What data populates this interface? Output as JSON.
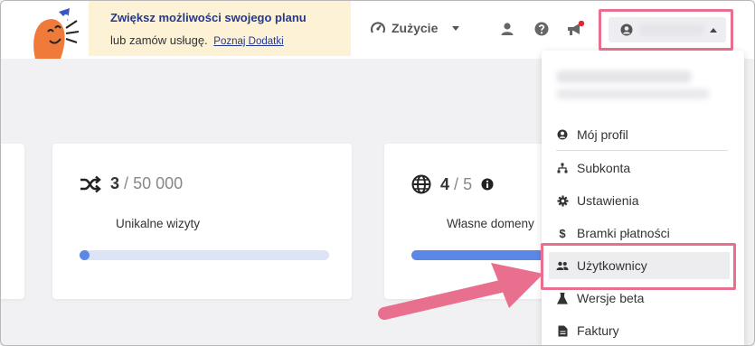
{
  "promo": {
    "title": "Zwiększ możliwości swojego planu",
    "line": "lub zamów usługę.",
    "link": "Poznaj Dodatki"
  },
  "header": {
    "usage_label": "Zużycie",
    "icons": [
      "speedometer-icon",
      "user-icon",
      "help-icon",
      "megaphone-icon",
      "account-icon"
    ]
  },
  "cards": [
    {
      "icon": "shuffle-icon",
      "current": "3",
      "separator": "/",
      "max": "50 000",
      "label": "Unikalne wizyty",
      "progress_fraction": 6e-05
    },
    {
      "icon": "globe-icon",
      "current": "4",
      "separator": "/",
      "max": "5",
      "label": "Własne domeny",
      "progress_fraction": 0.8
    }
  ],
  "dropdown": {
    "items": [
      {
        "label": "Mój profil",
        "icon": "user-circle-icon"
      },
      {
        "label": "Subkonta",
        "icon": "sitemap-icon"
      },
      {
        "label": "Ustawienia",
        "icon": "gear-icon"
      },
      {
        "label": "Bramki płatności",
        "icon": "dollar-icon"
      },
      {
        "label": "Użytkownicy",
        "icon": "users-icon"
      },
      {
        "label": "Wersje beta",
        "icon": "flask-icon"
      },
      {
        "label": "Faktury",
        "icon": "invoice-icon"
      }
    ]
  },
  "colors": {
    "promo_bg": "#fdf2d6",
    "promo_text": "#22388f",
    "highlight": "#e8708e",
    "bar_fill": "#5b87e6",
    "bar_track": "#dde4f8",
    "notification_dot": "#e3262e"
  }
}
